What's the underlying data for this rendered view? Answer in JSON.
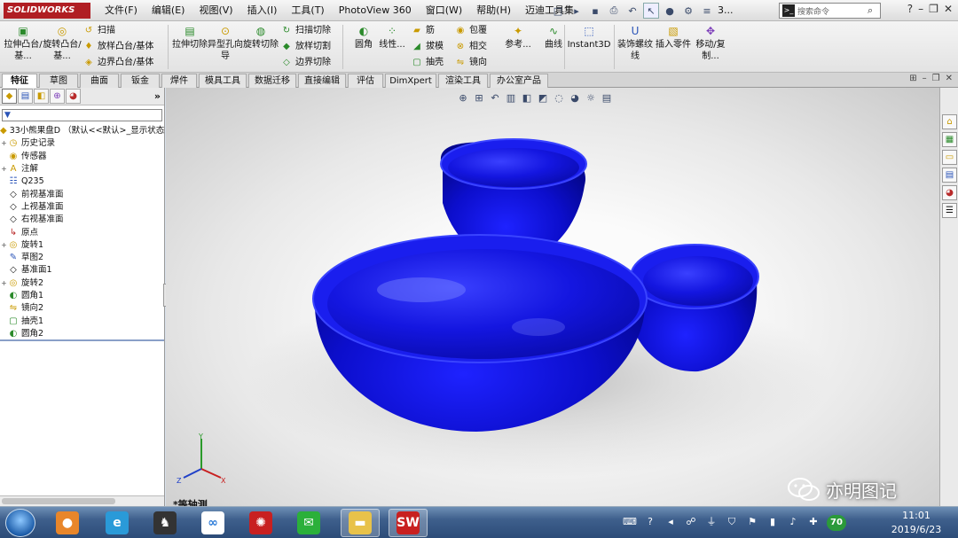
{
  "app": {
    "logo": "SOLIDWORKS"
  },
  "menu": [
    "文件(F)",
    "编辑(E)",
    "视图(V)",
    "插入(I)",
    "工具(T)",
    "PhotoView 360",
    "窗口(W)",
    "帮助(H)",
    "迈迪工具集"
  ],
  "quickaccess": {
    "trailing_text": "3..."
  },
  "search": {
    "placeholder": "搜索命令"
  },
  "commandmanager": {
    "extrude_boss": "拉伸凸台/基...",
    "revolve_boss": "旋转凸台/基...",
    "sweep": "扫描",
    "loft_boss": "放样凸台/基体",
    "boundary_boss": "边界凸台/基体",
    "extrude_cut": "拉伸切除",
    "hole_wizard": "异型孔向导",
    "revolve_cut": "旋转切除",
    "sweep_cut": "扫描切除",
    "loft_cut": "放样切割",
    "boundary_cut": "边界切除",
    "fillet": "圆角",
    "linear_pattern": "线性...",
    "rib": "筋",
    "draft": "拔模",
    "shell": "抽壳",
    "wrap": "包覆",
    "intersect": "相交",
    "mirror": "镜向",
    "reference": "参考...",
    "curves": "曲线",
    "instant3d": "Instant3D",
    "cosmetic_thread": "装饰螺纹线",
    "insert_part": "插入零件",
    "move_copy": "移动/复制..."
  },
  "tabs": [
    {
      "label": "特征",
      "active": true
    },
    {
      "label": "草图"
    },
    {
      "label": "曲面"
    },
    {
      "label": "钣金"
    },
    {
      "label": "焊件"
    },
    {
      "label": "模具工具"
    },
    {
      "label": "数据迁移"
    },
    {
      "label": "直接编辑"
    },
    {
      "label": "评估"
    },
    {
      "label": "DimXpert"
    },
    {
      "label": "渲染工具"
    },
    {
      "label": "办公室产品"
    }
  ],
  "feature_tree": {
    "root": "33小熊果盘D （默认<<默认>_显示状态",
    "items": [
      {
        "label": "历史记录",
        "expand": "+"
      },
      {
        "label": "传感器",
        "expand": ""
      },
      {
        "label": "注解",
        "expand": "+"
      },
      {
        "label": "Q235",
        "expand": ""
      },
      {
        "label": "前视基准面",
        "expand": ""
      },
      {
        "label": "上视基准面",
        "expand": ""
      },
      {
        "label": "右视基准面",
        "expand": ""
      },
      {
        "label": "原点",
        "expand": ""
      },
      {
        "label": "旋转1",
        "expand": "+"
      },
      {
        "label": "草图2",
        "expand": ""
      },
      {
        "label": "基准面1",
        "expand": ""
      },
      {
        "label": "旋转2",
        "expand": "+"
      },
      {
        "label": "圆角1",
        "expand": ""
      },
      {
        "label": "镜向2",
        "expand": ""
      },
      {
        "label": "抽壳1",
        "expand": ""
      },
      {
        "label": "圆角2",
        "expand": ""
      }
    ]
  },
  "viewport": {
    "view_label": "*等轴测",
    "model_color": "#1010d8"
  },
  "triad": {
    "x": "X",
    "y": "Y",
    "z": "Z"
  },
  "watermark": "亦明图记",
  "tray": {
    "badge": "70"
  },
  "clock": {
    "time": "11:01",
    "date": "2019/6/23"
  }
}
